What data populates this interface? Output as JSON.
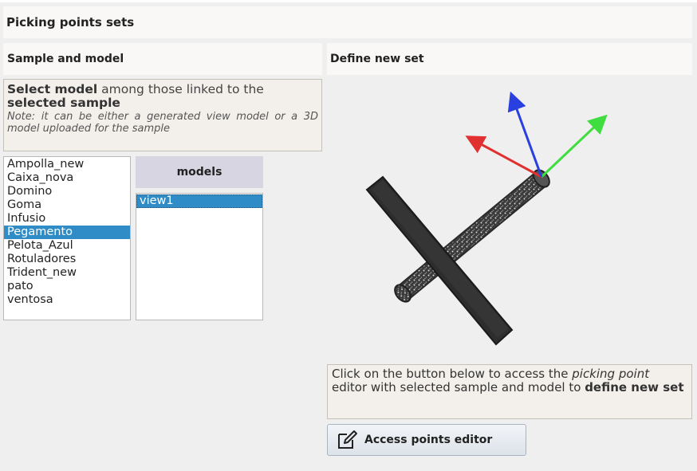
{
  "title": "Picking points sets",
  "left_panel": {
    "header": "Sample and model",
    "instructions": {
      "t1": "Select model",
      "t2": " among those linked to the ",
      "t3": "selected sample",
      "note": "Note: it can be either a generated view model or a 3D model uploaded for the sample"
    },
    "samples": [
      "Ampolla_new",
      "Caixa_nova",
      "Domino",
      "Goma",
      "Infusio",
      "Pegamento",
      "Pelota_Azul",
      "Rotuladores",
      "Trident_new",
      "pato",
      "ventosa"
    ],
    "selected_sample": "Pegamento",
    "models_header": "models",
    "models": [
      "view1"
    ],
    "selected_model": "view1"
  },
  "right_panel": {
    "header": "Define new set",
    "viewer_icon": "3d-model-viewer-with-axes",
    "axis_colors": {
      "x": "#e03030",
      "y": "#40dd40",
      "z": "#2a3fe0"
    },
    "info": {
      "t1": "Click on the button below to access the ",
      "t2": "picking point",
      "t3": " editor with selected sample and model to ",
      "t4": "define new set"
    },
    "button_label": "Access points editor",
    "button_icon": "edit-icon"
  }
}
